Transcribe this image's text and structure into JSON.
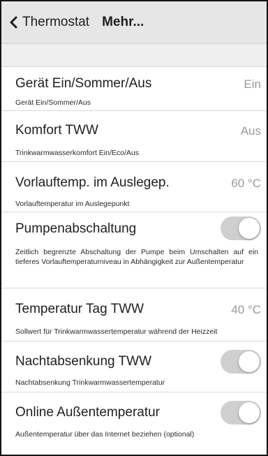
{
  "navbar": {
    "back_label": "Thermostat",
    "title": "Mehr..."
  },
  "colors": {
    "navbar_bg": "#e6e6e6",
    "value_gray": "#9a9a9a",
    "toggle_track": "#cfcfcf"
  },
  "settings": [
    {
      "title": "Gerät Ein/Sommer/Aus",
      "value": "Ein",
      "description": "Gerät Ein/Sommer/Aus"
    },
    {
      "title": "Komfort TWW",
      "value": "Aus",
      "description": "Trinkwarmwasserkomfort Ein/Eco/Aus"
    },
    {
      "title": "Vorlauftemp. im Auslegep.",
      "value": "60 °C",
      "description": "Vorlauftemperatur im Auslegepunkt"
    },
    {
      "title": "Pumpenabschaltung",
      "toggle_on": false,
      "description": "Zeitlich begrenzte Abschaltung der Pumpe beim Umschalten auf ein tieferes Vorlauftemperaturniveau in Abhängigkeit zur Außentemperatur"
    },
    {
      "title": "Temperatur Tag TWW",
      "value": "40 °C",
      "description": "Sollwert für Trinkwarmwassertemperatur während der Heizzeit"
    },
    {
      "title": "Nachtabsenkung TWW",
      "toggle_on": false,
      "description": "Nachtabsenkung Trinkwarmwassertemperatur"
    },
    {
      "title": "Online Außentemperatur",
      "toggle_on": false,
      "description": "Außentemperatur über das Internet beziehen (optional)"
    }
  ]
}
